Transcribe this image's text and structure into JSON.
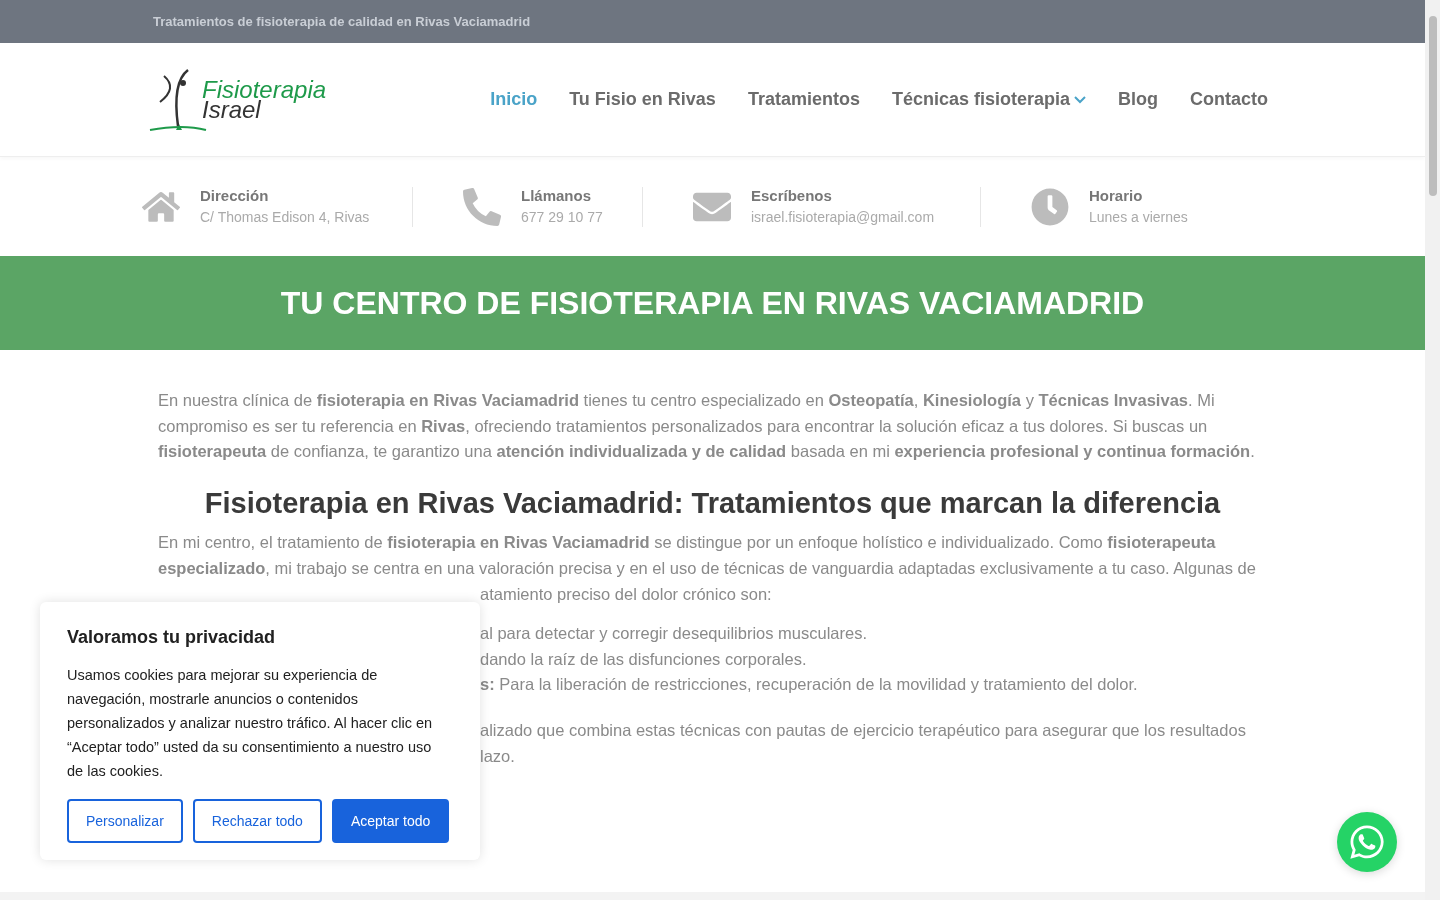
{
  "top_bar": {
    "text": "Tratamientos de fisioterapia de calidad en Rivas Vaciamadrid"
  },
  "logo": {
    "line1": "Fisioterapia",
    "line2": "Israel"
  },
  "nav": [
    {
      "label": "Inicio",
      "selected": true,
      "has_dropdown": false
    },
    {
      "label": "Tu Fisio en Rivas",
      "selected": false,
      "has_dropdown": false
    },
    {
      "label": "Tratamientos",
      "selected": false,
      "has_dropdown": false
    },
    {
      "label": "Técnicas fisioterapia",
      "selected": false,
      "has_dropdown": true
    },
    {
      "label": "Blog",
      "selected": false,
      "has_dropdown": false
    },
    {
      "label": "Contacto",
      "selected": false,
      "has_dropdown": false
    }
  ],
  "info": [
    {
      "kind": "home",
      "title": "Dirección",
      "value": "C/ Thomas Edison 4, Rivas"
    },
    {
      "kind": "phone",
      "title": "Llámanos",
      "value": "677 29 10 77"
    },
    {
      "kind": "mail",
      "title": "Escríbenos",
      "value": "israel.fisioterapia@gmail.com"
    },
    {
      "kind": "clock",
      "title": "Horario",
      "value": "Lunes a viernes"
    }
  ],
  "hero": {
    "title": "TU CENTRO DE FISIOTERAPIA EN RIVAS VACIAMADRID"
  },
  "content": {
    "intro": "En nuestra clínica de **fisioterapia en Rivas Vaciamadrid** tienes tu centro especializado en **Osteopatía**, **Kinesiología** y **Técnicas Invasivas**. Mi compromiso es ser tu referencia en **Rivas**, ofreciendo tratamientos personalizados para encontrar la solución eficaz a tus dolores. Si buscas un **fisioterapeuta** de confianza, te garantizo una **atención individualizada y de calidad** basada en mi **experiencia profesional y continua formación**.",
    "heading": "Fisioterapia en Rivas Vaciamadrid: Tratamientos que marcan la diferencia",
    "para2_lines": [
      "En mi centro, el tratamiento de **fisioterapia en Rivas Vaciamadrid** se distingue por un enfoque holístico e individualizado. Como **fisioterapeuta**",
      "**especializado**, mi trabajo se centra en una valoración precisa y en el uso de técnicas de vanguardia adaptadas exclusivamente a tu caso. Algunas de"
    ],
    "para2_visible_end": "atamiento preciso del dolor crónico son:",
    "list_fragments": [
      "al para detectar y corregir desequilibrios musculares.",
      "dando la raíz de las disfunciones corporales.",
      "**s:** Para la liberación de restricciones, recuperación de la movilidad y tratamiento del dolor."
    ],
    "closing_fragments": [
      "alizado que combina estas técnicas con pautas de ejercicio terapéutico para asegurar que los resultados",
      "lazo."
    ]
  },
  "cookie_banner": {
    "title": "Valoramos tu privacidad",
    "body": "Usamos cookies para mejorar su experiencia de navegación, mostrarle anuncios o contenidos personalizados y analizar nuestro tráfico. Al hacer clic en “Aceptar todo” usted da su consentimiento a nuestro uso de las cookies.",
    "buttons": [
      {
        "label": "Personalizar",
        "kind": "outline"
      },
      {
        "label": "Rechazar todo",
        "kind": "outline"
      },
      {
        "label": "Aceptar todo",
        "kind": "primary"
      }
    ]
  }
}
